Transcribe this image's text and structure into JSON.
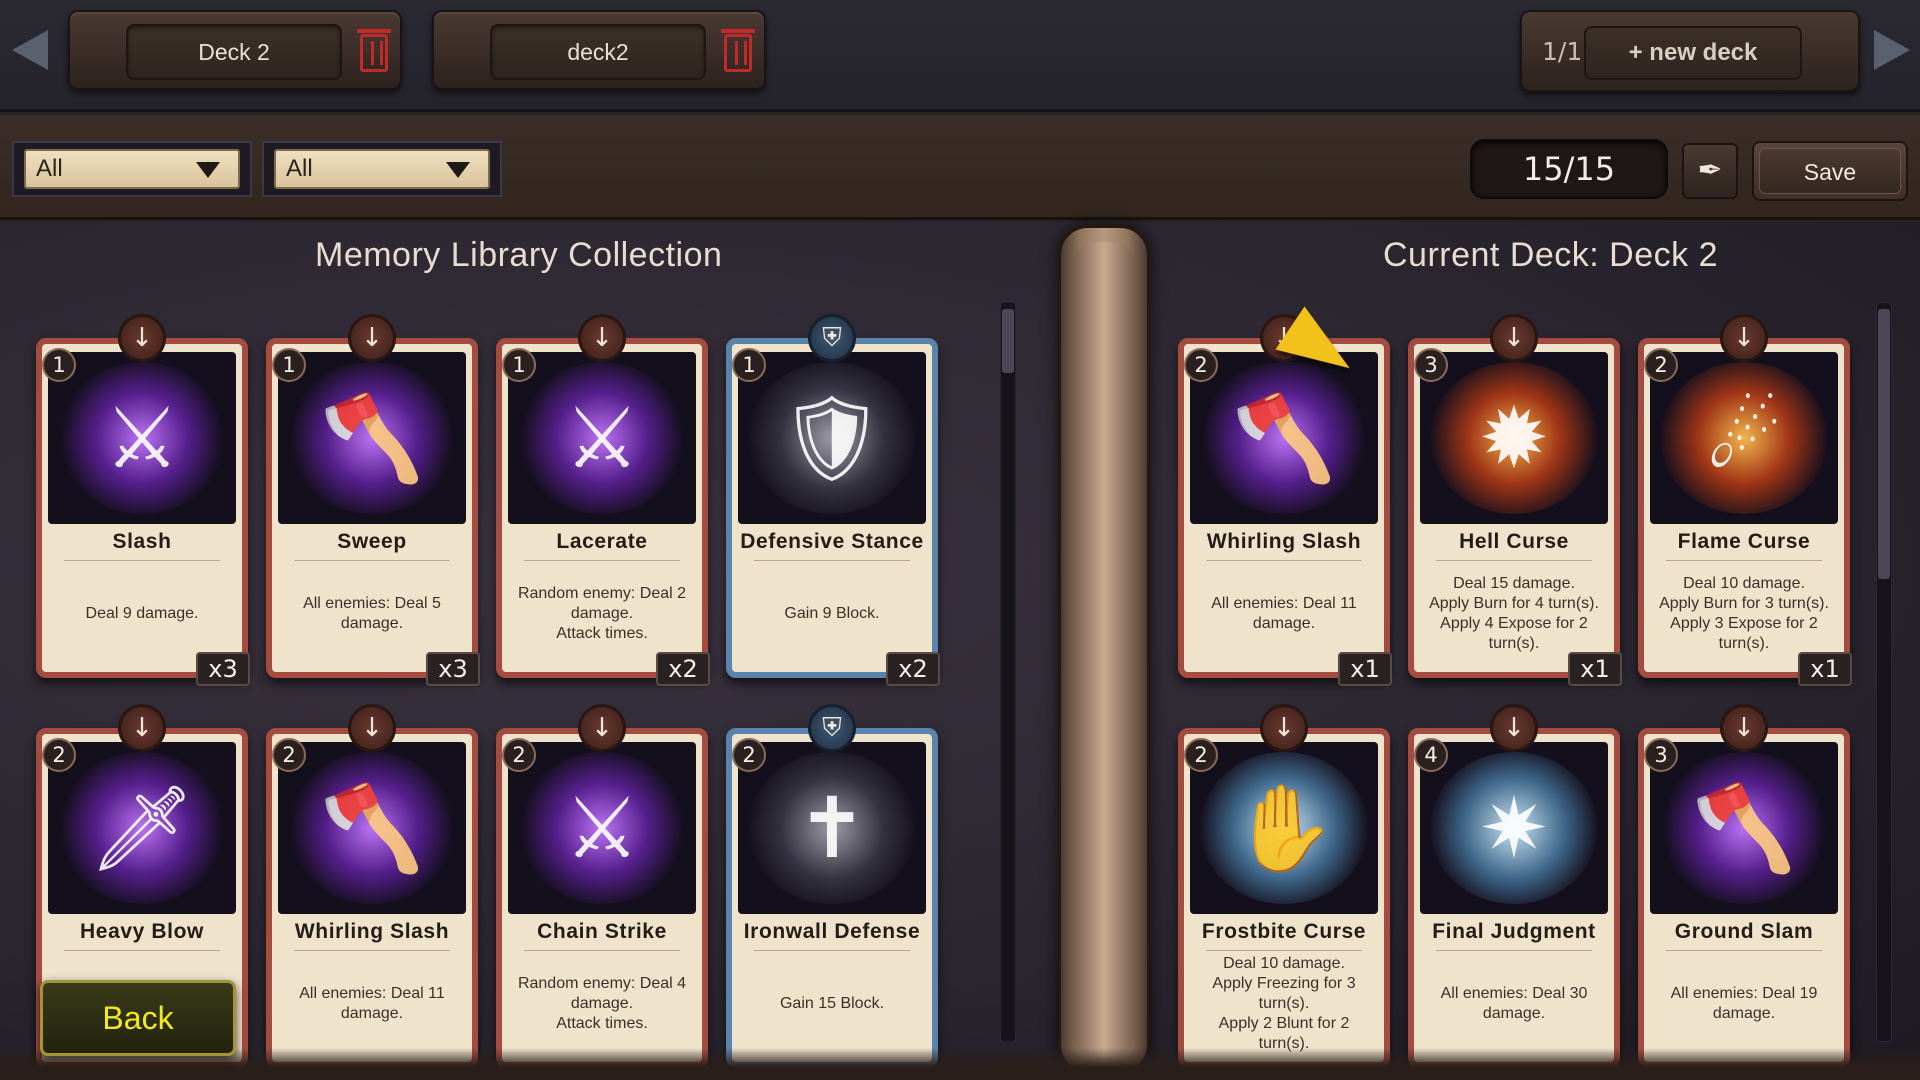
{
  "topbar": {
    "decks": [
      {
        "label": "Deck 2"
      },
      {
        "label": "deck2"
      }
    ],
    "page_count": "1/1",
    "new_deck_label": "+ new deck"
  },
  "filters": {
    "filter1": "All",
    "filter2": "All"
  },
  "deck_counter": "15/15",
  "quill_icon": "✒",
  "save_label": "Save",
  "library": {
    "title": "Memory Library Collection",
    "cards": [
      {
        "name": "Slash",
        "cost": "1",
        "type": "attack",
        "type_glyph": "↓",
        "desc": "Deal 9 damage.",
        "qty": "x3",
        "art": "glow",
        "art_glyph": "⚔"
      },
      {
        "name": "Sweep",
        "cost": "1",
        "type": "attack",
        "type_glyph": "↓",
        "desc": "All enemies: Deal 5 damage.",
        "qty": "x3",
        "art": "glow",
        "art_glyph": "🪓"
      },
      {
        "name": "Lacerate",
        "cost": "1",
        "type": "attack",
        "type_glyph": "↓",
        "desc": "Random enemy: Deal 2 damage.\nAttack   times.",
        "qty": "x2",
        "art": "glow",
        "art_glyph": "⚔"
      },
      {
        "name": "Defensive Stance",
        "cost": "1",
        "type": "defense",
        "type_glyph": "⛨",
        "desc": "Gain 9 Block.",
        "qty": "x2",
        "art": "steel",
        "art_glyph": "🛡"
      },
      {
        "name": "Heavy Blow",
        "cost": "2",
        "type": "attack",
        "type_glyph": "↓",
        "desc": "",
        "qty": "",
        "art": "glow",
        "art_glyph": "🗡"
      },
      {
        "name": "Whirling Slash",
        "cost": "2",
        "type": "attack",
        "type_glyph": "↓",
        "desc": "All enemies: Deal 11 damage.",
        "qty": "",
        "art": "glow",
        "art_glyph": "🪓"
      },
      {
        "name": "Chain Strike",
        "cost": "2",
        "type": "attack",
        "type_glyph": "↓",
        "desc": "Random enemy: Deal 4 damage.\nAttack   times.",
        "qty": "",
        "art": "glow",
        "art_glyph": "⚔"
      },
      {
        "name": "Ironwall Defense",
        "cost": "2",
        "type": "defense",
        "type_glyph": "⛨",
        "desc": "Gain 15 Block.",
        "qty": "",
        "art": "steel",
        "art_glyph": "✝"
      }
    ]
  },
  "deck": {
    "title": "Current Deck: Deck 2",
    "cards": [
      {
        "name": "Whirling Slash",
        "cost": "2",
        "type": "attack",
        "type_glyph": "↓",
        "desc": "All enemies: Deal 11 damage.",
        "qty": "x1",
        "art": "glow",
        "art_glyph": "🪓"
      },
      {
        "name": "Hell Curse",
        "cost": "3",
        "type": "attack",
        "type_glyph": "↓",
        "desc": "Deal 15 damage.\nApply Burn for 4 turn(s).\nApply 4 Expose for 2 turn(s).",
        "qty": "x1",
        "art": "fire",
        "art_glyph": "✹"
      },
      {
        "name": "Flame Curse",
        "cost": "2",
        "type": "attack",
        "type_glyph": "↓",
        "desc": "Deal 10 damage.\nApply Burn for 3 turn(s).\nApply 3 Expose for 2 turn(s).",
        "qty": "x1",
        "art": "fire",
        "art_glyph": "☄"
      },
      {
        "name": "Frostbite Curse",
        "cost": "2",
        "type": "attack",
        "type_glyph": "↓",
        "desc": "Deal 10 damage.\nApply Freezing for 3 turn(s).\nApply 2 Blunt for 2 turn(s).",
        "qty": "",
        "art": "ice",
        "art_glyph": "✋"
      },
      {
        "name": "Final Judgment",
        "cost": "4",
        "type": "attack",
        "type_glyph": "↓",
        "desc": "All enemies: Deal 30 damage.",
        "qty": "",
        "art": "ice",
        "art_glyph": "✷"
      },
      {
        "name": "Ground Slam",
        "cost": "3",
        "type": "attack",
        "type_glyph": "↓",
        "desc": "All enemies: Deal 19 damage.",
        "qty": "",
        "art": "glow",
        "art_glyph": "🪓"
      }
    ]
  },
  "back_label": "Back"
}
